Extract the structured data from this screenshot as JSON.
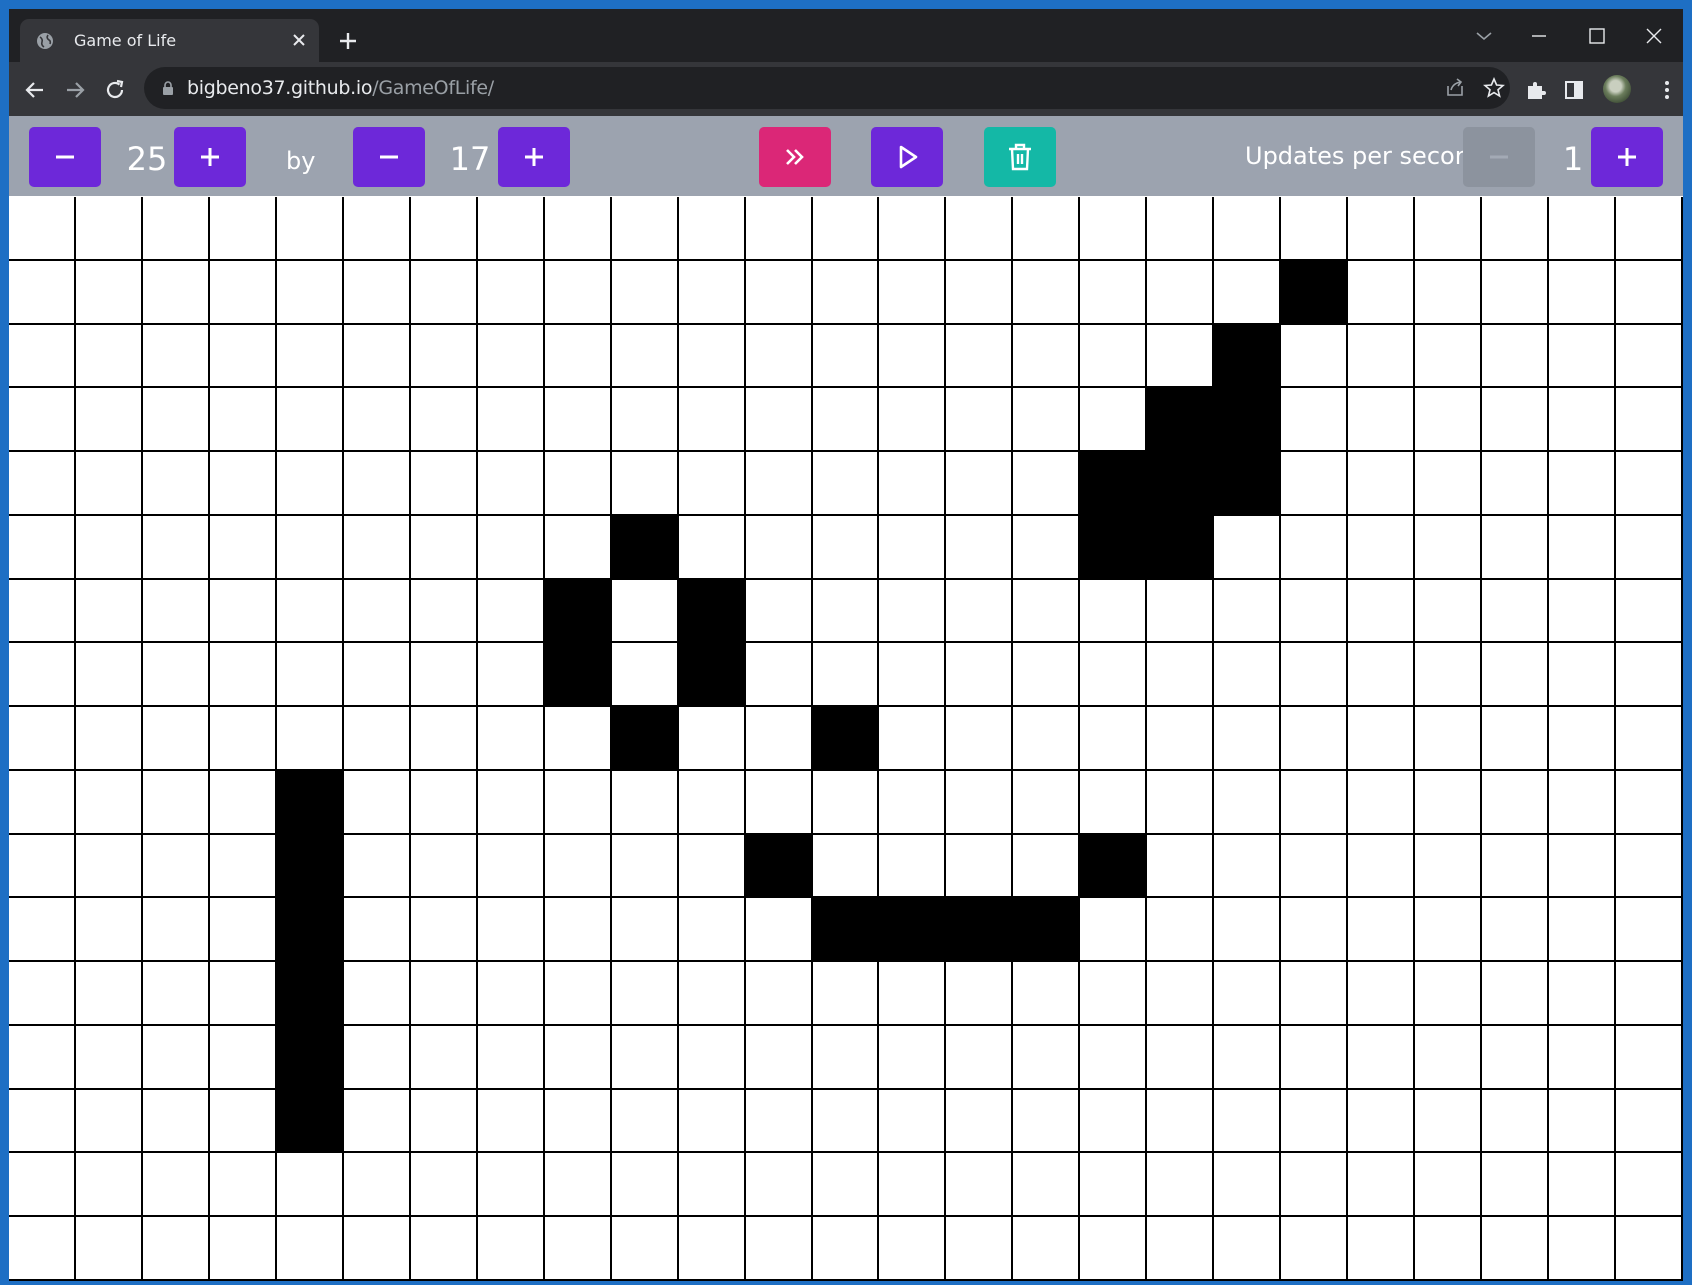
{
  "browser": {
    "tab_title": "Game of Life",
    "url_host": "bigbeno37.github.io",
    "url_path": "/GameOfLife/"
  },
  "controls": {
    "width_value": "25",
    "by_label": "by",
    "height_value": "17",
    "speed_label": "Updates per second:",
    "speed_value": "1"
  },
  "colors": {
    "primary": "#6d28d9",
    "step": "#db2777",
    "clear": "#14b8a6",
    "disabled": "#8c939e",
    "controls_bar": "#9ca3af",
    "alive": "#000000",
    "dead": "#ffffff"
  },
  "icons": [
    "globe-icon",
    "close-icon",
    "plus-icon",
    "back-icon",
    "forward-icon",
    "reload-icon",
    "lock-icon",
    "share-icon",
    "star-icon",
    "extensions-icon",
    "side-panel-icon",
    "more-icon",
    "minus-icon",
    "fast-forward-icon",
    "play-icon",
    "trash-icon"
  ],
  "grid": {
    "cols": 25,
    "rows": 17,
    "alive": [
      [
        1,
        19
      ],
      [
        2,
        18
      ],
      [
        3,
        17
      ],
      [
        3,
        18
      ],
      [
        4,
        16
      ],
      [
        4,
        17
      ],
      [
        4,
        18
      ],
      [
        5,
        9
      ],
      [
        5,
        16
      ],
      [
        5,
        17
      ],
      [
        6,
        8
      ],
      [
        6,
        10
      ],
      [
        7,
        8
      ],
      [
        7,
        10
      ],
      [
        8,
        9
      ],
      [
        8,
        12
      ],
      [
        9,
        4
      ],
      [
        10,
        4
      ],
      [
        10,
        11
      ],
      [
        10,
        16
      ],
      [
        11,
        4
      ],
      [
        11,
        12
      ],
      [
        11,
        13
      ],
      [
        11,
        14
      ],
      [
        11,
        15
      ],
      [
        12,
        4
      ],
      [
        13,
        4
      ],
      [
        14,
        4
      ]
    ]
  }
}
